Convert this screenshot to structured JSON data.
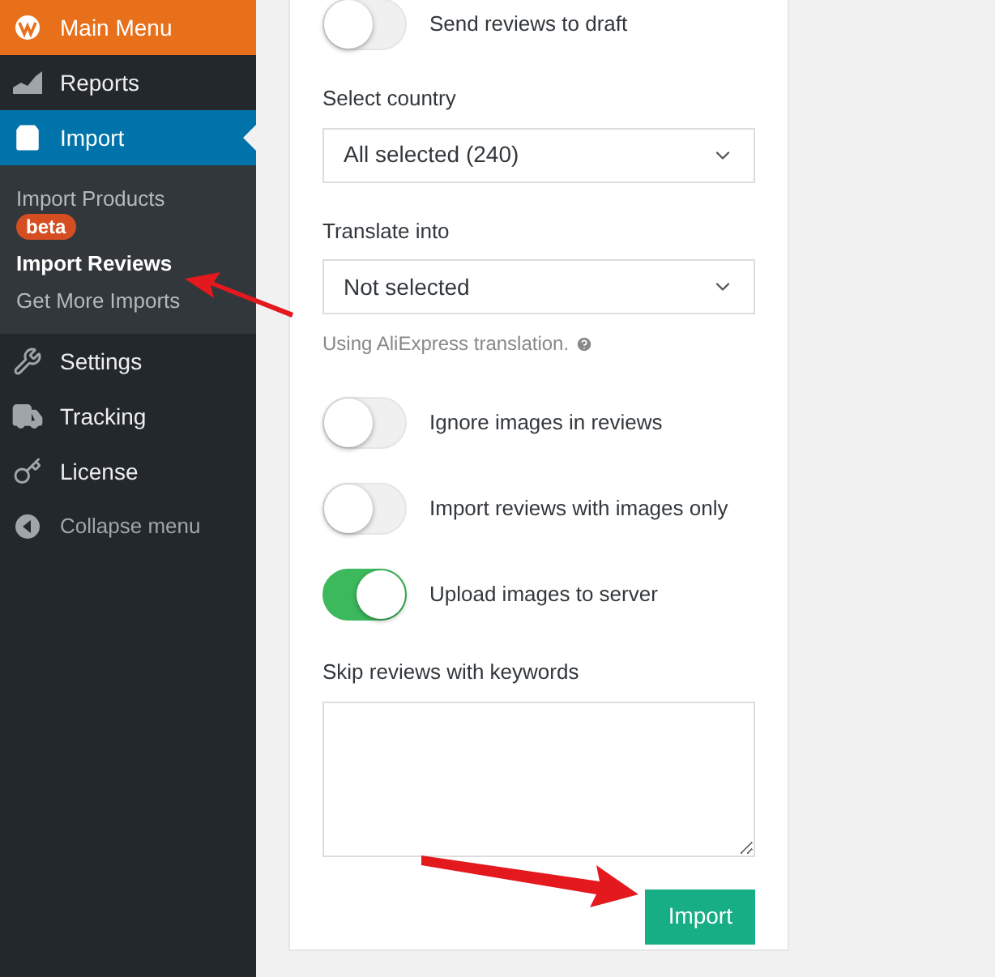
{
  "sidebar": {
    "items": [
      {
        "kind": "header",
        "label": "Main Menu"
      },
      {
        "kind": "item",
        "label": "Reports",
        "selected": false
      },
      {
        "kind": "item",
        "label": "Import",
        "selected": true,
        "children": [
          {
            "label": "Import Products",
            "badge": "beta",
            "selected": false
          },
          {
            "label": "Import Reviews",
            "selected": true
          },
          {
            "label": "Get More Imports",
            "selected": false
          }
        ]
      },
      {
        "kind": "item",
        "label": "Settings",
        "selected": false
      },
      {
        "kind": "item",
        "label": "Tracking",
        "selected": false
      },
      {
        "kind": "item",
        "label": "License",
        "selected": false
      },
      {
        "kind": "collapse",
        "label": "Collapse menu"
      }
    ]
  },
  "form": {
    "top_toggle": {
      "label": "Send reviews to draft",
      "on": false
    },
    "country": {
      "label": "Select country",
      "value": "All selected (240)"
    },
    "translate": {
      "label": "Translate into",
      "value": "Not selected",
      "hint": "Using AliExpress translation."
    },
    "toggles": [
      {
        "label": "Ignore images in reviews",
        "on": false
      },
      {
        "label": "Import reviews with images only",
        "on": false
      },
      {
        "label": "Upload images to server",
        "on": true
      }
    ],
    "keywords": {
      "label": "Skip reviews with keywords"
    },
    "button": "Import"
  }
}
